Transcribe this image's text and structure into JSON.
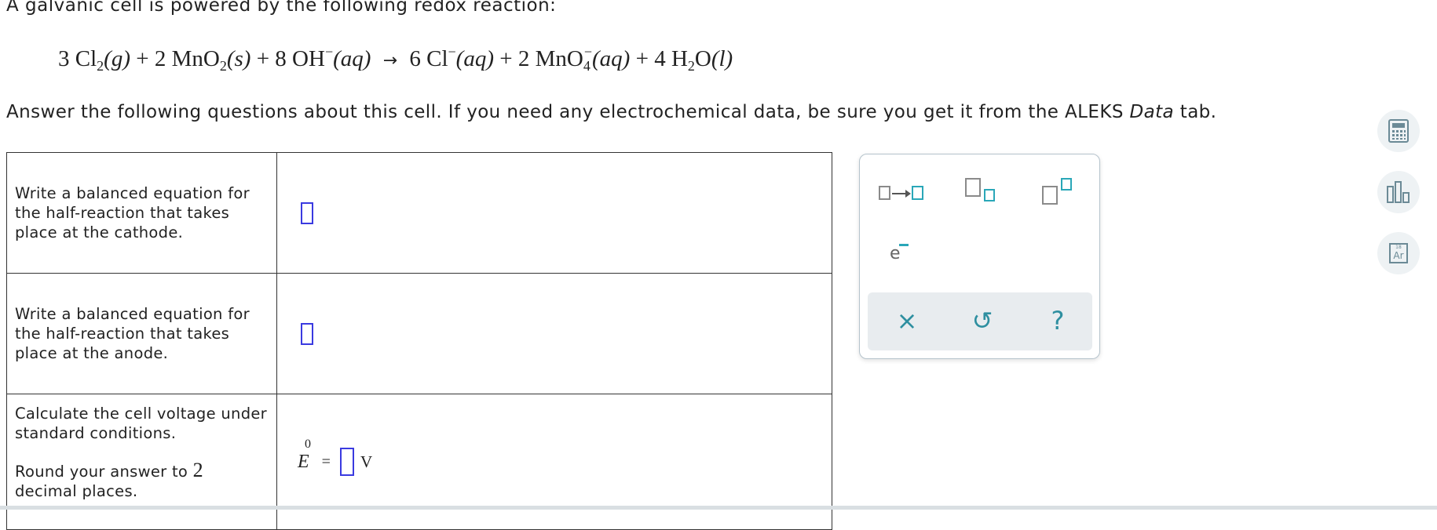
{
  "intro": "A galvanic cell is powered by the following redox reaction:",
  "reaction": {
    "r1_coef": "3",
    "r1": "Cl",
    "r1_sub": "2",
    "r1_state": "(g)",
    "plus1": "+",
    "r2_coef": "2",
    "r2": "MnO",
    "r2_sub": "2",
    "r2_state": "(s)",
    "plus2": "+",
    "r3_coef": "8",
    "r3": "OH",
    "r3_sup": "−",
    "r3_state": "(aq)",
    "arrow": "→",
    "p1_coef": "6",
    "p1": "Cl",
    "p1_sup": "−",
    "p1_state": "(aq)",
    "plus3": "+",
    "p2_coef": "2",
    "p2": "MnO",
    "p2_sub": "4",
    "p2_sup": "−",
    "p2_state": "(aq)",
    "plus4": "+",
    "p3_coef": "4",
    "p3a": "H",
    "p3_sub": "2",
    "p3b": "O",
    "p3_state": "(l)"
  },
  "answer_intro": {
    "before": "Answer the following questions about this cell. If you need any electrochemical data, be sure you get it from the ALEKS ",
    "italic": "Data",
    "after": " tab."
  },
  "questions": {
    "cathode": "Write a balanced equation for the half-reaction that takes place at the cathode.",
    "anode": "Write a balanced equation for the half-reaction that takes place at the anode.",
    "voltage": "Calculate the cell voltage under standard conditions.",
    "round_pre": "Round your answer to ",
    "round_num": "2",
    "round_post": " decimal places."
  },
  "voltage_answer": {
    "symbol": "E",
    "superscript": "0",
    "equals": "=",
    "unit": "V"
  },
  "palette": {
    "electron_label": "e",
    "clear_icon": "×",
    "undo_icon": "↺",
    "help_icon": "?"
  },
  "side_tools": {
    "periodic_table_number": "18",
    "periodic_table_symbol": "Ar"
  },
  "colors": {
    "accent": "#2aa7b8",
    "answer_box": "#3a3ae0"
  }
}
